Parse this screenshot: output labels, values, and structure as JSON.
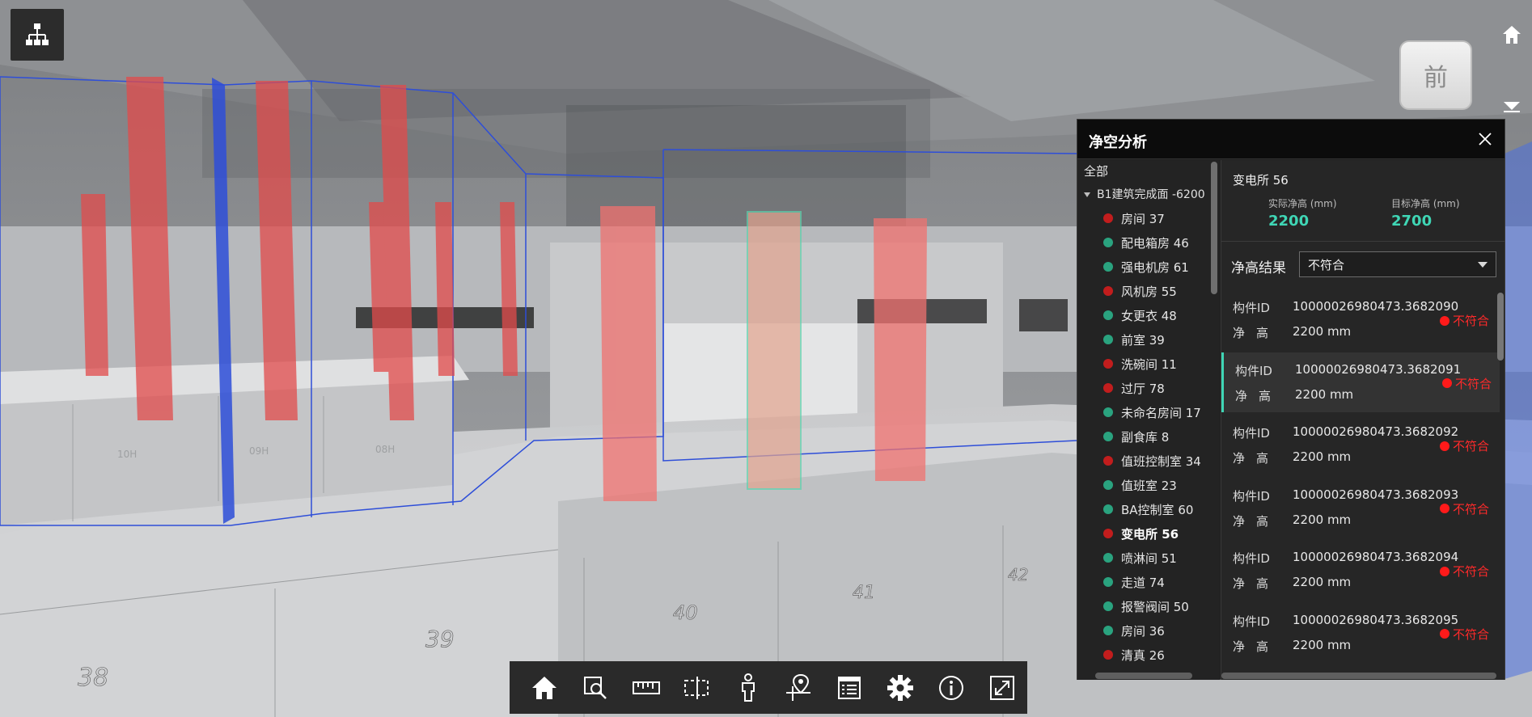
{
  "view": {
    "cube_face_label": "前",
    "zone_labels": [
      "38",
      "39",
      "40",
      "41",
      "42"
    ],
    "room_tags": [
      "10H",
      "09H",
      "08H"
    ]
  },
  "panel": {
    "title": "净空分析",
    "tree": {
      "root": "全部",
      "level1": "B1建筑完成面 -6200",
      "items": [
        {
          "label": "房间 37",
          "status": "fail"
        },
        {
          "label": "配电箱房 46",
          "status": "pass"
        },
        {
          "label": "强电机房 61",
          "status": "pass"
        },
        {
          "label": "风机房 55",
          "status": "fail"
        },
        {
          "label": "女更衣 48",
          "status": "pass"
        },
        {
          "label": "前室 39",
          "status": "pass"
        },
        {
          "label": "洗碗间 11",
          "status": "fail"
        },
        {
          "label": "过厅 78",
          "status": "fail"
        },
        {
          "label": "未命名房间 17",
          "status": "pass"
        },
        {
          "label": "副食库 8",
          "status": "pass"
        },
        {
          "label": "值班控制室 34",
          "status": "fail"
        },
        {
          "label": "值班室 23",
          "status": "pass"
        },
        {
          "label": "BA控制室 60",
          "status": "pass"
        },
        {
          "label": "变电所 56",
          "status": "fail",
          "active": true
        },
        {
          "label": "喷淋间 51",
          "status": "pass"
        },
        {
          "label": "走道 74",
          "status": "pass"
        },
        {
          "label": "报警阀间 50",
          "status": "pass"
        },
        {
          "label": "房间 36",
          "status": "pass"
        },
        {
          "label": "清真 26",
          "status": "fail"
        }
      ]
    },
    "detail": {
      "name": "变电所 56",
      "actual_label": "实际净高 (mm)",
      "actual_value": "2200",
      "target_label": "目标净高 (mm)",
      "target_value": "2700",
      "result_label": "净高结果",
      "result_selected": "不符合",
      "rows": [
        {
          "id_label": "构件ID",
          "id": "10000026980473.3682090",
          "h_label": "净高",
          "h": "2200 mm",
          "status": "不符合"
        },
        {
          "id_label": "构件ID",
          "id": "10000026980473.3682091",
          "h_label": "净高",
          "h": "2200 mm",
          "status": "不符合",
          "selected": true
        },
        {
          "id_label": "构件ID",
          "id": "10000026980473.3682092",
          "h_label": "净高",
          "h": "2200 mm",
          "status": "不符合"
        },
        {
          "id_label": "构件ID",
          "id": "10000026980473.3682093",
          "h_label": "净高",
          "h": "2200 mm",
          "status": "不符合"
        },
        {
          "id_label": "构件ID",
          "id": "10000026980473.3682094",
          "h_label": "净高",
          "h": "2200 mm",
          "status": "不符合"
        },
        {
          "id_label": "构件ID",
          "id": "10000026980473.3682095",
          "h_label": "净高",
          "h": "2200 mm",
          "status": "不符合"
        }
      ]
    }
  },
  "toolbar": {
    "buttons": [
      "home-icon",
      "zoom-region-icon",
      "ruler-icon",
      "section-box-icon",
      "person-icon",
      "locate-pin-icon",
      "properties-list-icon",
      "settings-gear-icon",
      "info-icon",
      "fullscreen-icon"
    ]
  },
  "colors": {
    "pass": "#2aa37f",
    "fail": "#c21d1d",
    "accent": "#3fd6b5",
    "status_red": "#ff2a2a"
  }
}
